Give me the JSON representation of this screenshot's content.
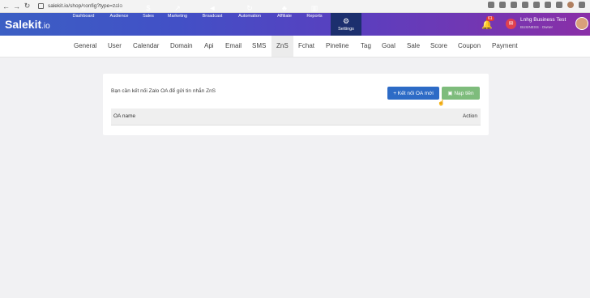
{
  "browser": {
    "url": "salekit.io/shop/config?type=zalo",
    "back_icon": "←",
    "forward_icon": "→",
    "reload_icon": "↻"
  },
  "app": {
    "logo": "Salekit",
    "logo_suffix": ".io"
  },
  "topnav": {
    "items": [
      {
        "label": "Dashboard",
        "icon": "⌂"
      },
      {
        "label": "Audience",
        "icon": "☷"
      },
      {
        "label": "Sales",
        "icon": "$"
      },
      {
        "label": "Marketing",
        "icon": "↗"
      },
      {
        "label": "Broadcast",
        "icon": "◄"
      },
      {
        "label": "Automation",
        "icon": "↻"
      },
      {
        "label": "Affiliate",
        "icon": "♣"
      },
      {
        "label": "Reports",
        "icon": "▥"
      },
      {
        "label": "Settings",
        "icon": "⚙"
      }
    ]
  },
  "header": {
    "notification_count": "61",
    "bell_icon": "🔔",
    "mail_icon": "✉",
    "business_name": "Lnhg Business Test",
    "business_sub": "BUSINESS · Owner"
  },
  "subnav": {
    "items": [
      "General",
      "User",
      "Calendar",
      "Domain",
      "Api",
      "Email",
      "SMS",
      "ZnS",
      "Fchat",
      "Pineline",
      "Tag",
      "Goal",
      "Sale",
      "Score",
      "Coupon",
      "Payment"
    ],
    "active": "ZnS"
  },
  "main": {
    "message": "Bạn cần kết nối Zalo OA để gửi tin nhắn ZnS",
    "connect_button": "+ Kết nối OA mới",
    "topup_button": "▣ Nạp tiền",
    "table": {
      "col_name": "OA name",
      "col_action": "Action"
    }
  }
}
